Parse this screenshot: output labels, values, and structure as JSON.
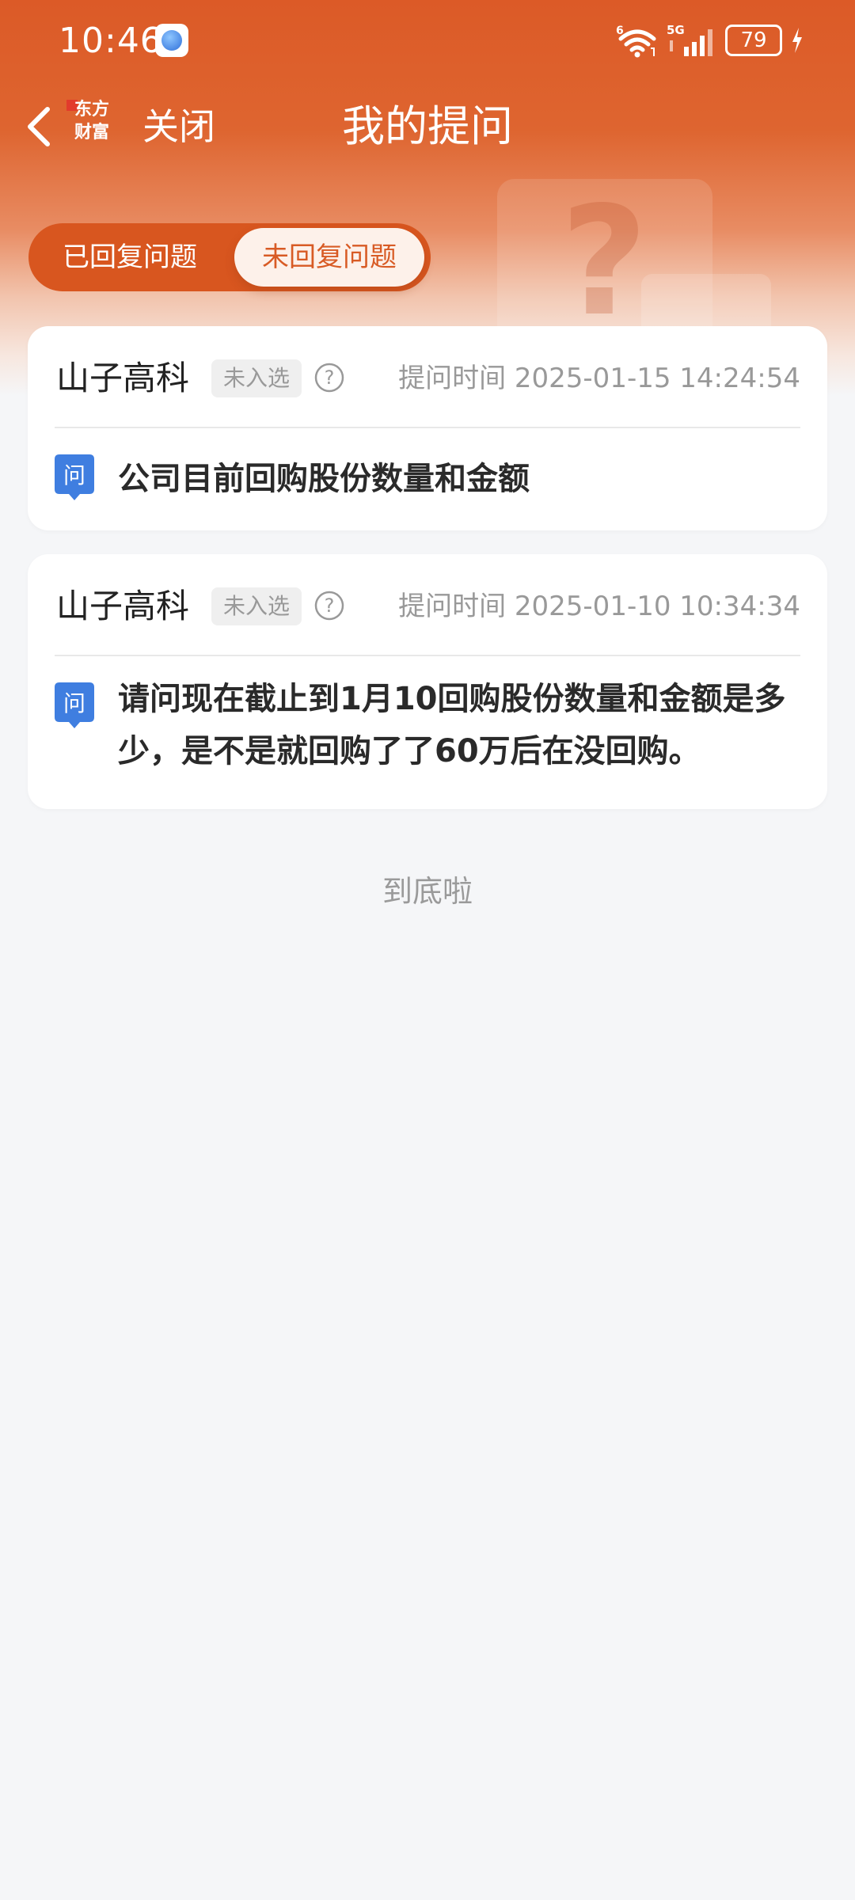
{
  "status_bar": {
    "time": "10:46",
    "network": "5G",
    "battery": "79",
    "app_icon": "browser-app-icon"
  },
  "nav": {
    "back_icon": "chevron-left-icon",
    "logo_text": "东方财富",
    "close_label": "关闭",
    "title": "我的提问"
  },
  "tabs": {
    "answered_label": "已回复问题",
    "unanswered_label": "未回复问题",
    "active": "unanswered"
  },
  "questions": [
    {
      "company": "山子高科",
      "badge": "未入选",
      "time_prefix": "提问时间",
      "time": "2025-01-15 14:24:54",
      "q_icon_label": "问",
      "text": "公司目前回购股份数量和金额"
    },
    {
      "company": "山子高科",
      "badge": "未入选",
      "time_prefix": "提问时间",
      "time": "2025-01-10 10:34:34",
      "q_icon_label": "问",
      "text": "请问现在截止到1月10回购股份数量和金额是多少，是不是就回购了了60万后在没回购。"
    }
  ],
  "footer": {
    "end_text": "到底啦"
  },
  "colors": {
    "brand": "#dc5a27",
    "tab_active_text": "#d85b25",
    "question_icon": "#3f7ee0"
  }
}
